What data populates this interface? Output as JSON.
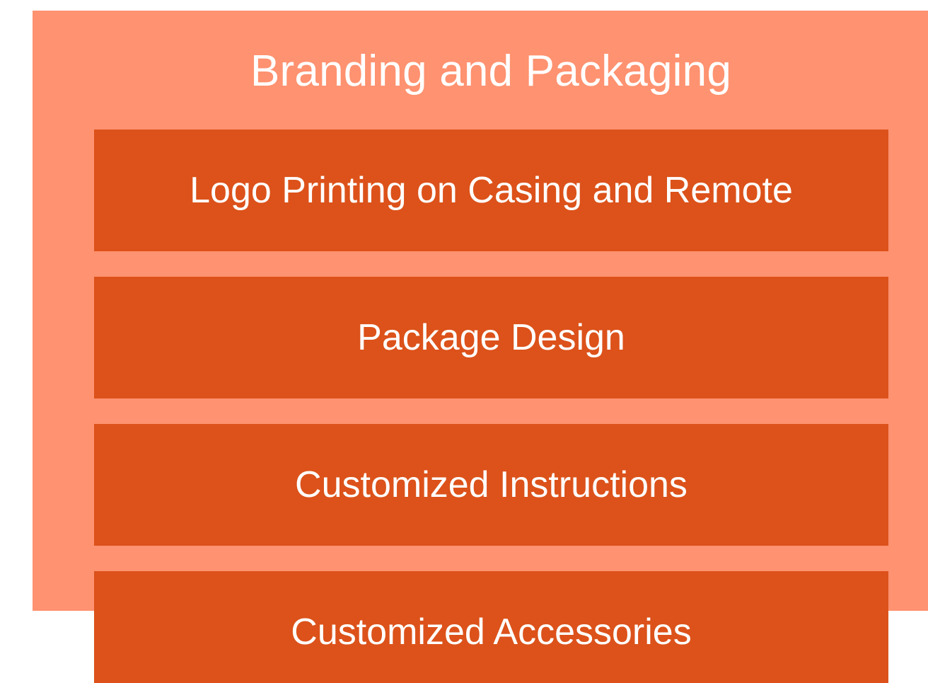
{
  "diagram": {
    "title": "Branding and Packaging",
    "items": [
      {
        "label": "Logo Printing on Casing and Remote"
      },
      {
        "label": "Package Design"
      },
      {
        "label": "Customized Instructions"
      },
      {
        "label": "Customized Accessories"
      }
    ]
  },
  "colors": {
    "outer_panel": "#ff9270",
    "item_box": "#dc521a",
    "text": "#ffffff",
    "background": "#ffffff"
  }
}
